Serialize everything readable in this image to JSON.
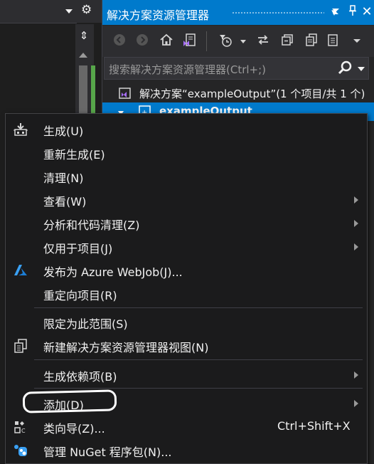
{
  "solution_explorer": {
    "title": "解决方案资源管理器",
    "search_placeholder": "搜索解决方案资源管理器(Ctrl+;)",
    "tree": {
      "solution_label": "解决方案“exampleOutput”(1 个项目/共 1 个)",
      "project_label": "exampleOutput"
    }
  },
  "context_menu": {
    "items": [
      {
        "label": "生成(U)",
        "icon": "build-icon"
      },
      {
        "label": "重新生成(E)"
      },
      {
        "label": "清理(N)"
      },
      {
        "label": "查看(W)",
        "submenu": true
      },
      {
        "label": "分析和代码清理(Z)",
        "submenu": true
      },
      {
        "label": "仅用于项目(J)",
        "submenu": true
      },
      {
        "label": "发布为 Azure WebJob(J)...",
        "icon": "azure-icon"
      },
      {
        "label": "重定向项目(R)"
      },
      {
        "label": "限定为此范围(S)"
      },
      {
        "label": "新建解决方案资源管理器视图(N)",
        "icon": "new-view-icon"
      },
      {
        "label": "生成依赖项(B)",
        "submenu": true
      },
      {
        "label": "添加(D)",
        "submenu": true
      },
      {
        "label": "类向导(Z)...",
        "icon": "class-wizard-icon",
        "shortcut": "Ctrl+Shift+X"
      },
      {
        "label": "管理 NuGet 程序包(N)...",
        "icon": "nuget-icon"
      }
    ]
  },
  "colors": {
    "accent": "#007acc",
    "menu_bg": "#1b1b1c",
    "panel_bg": "#252526",
    "toolbar_bg": "#2d2d30"
  }
}
